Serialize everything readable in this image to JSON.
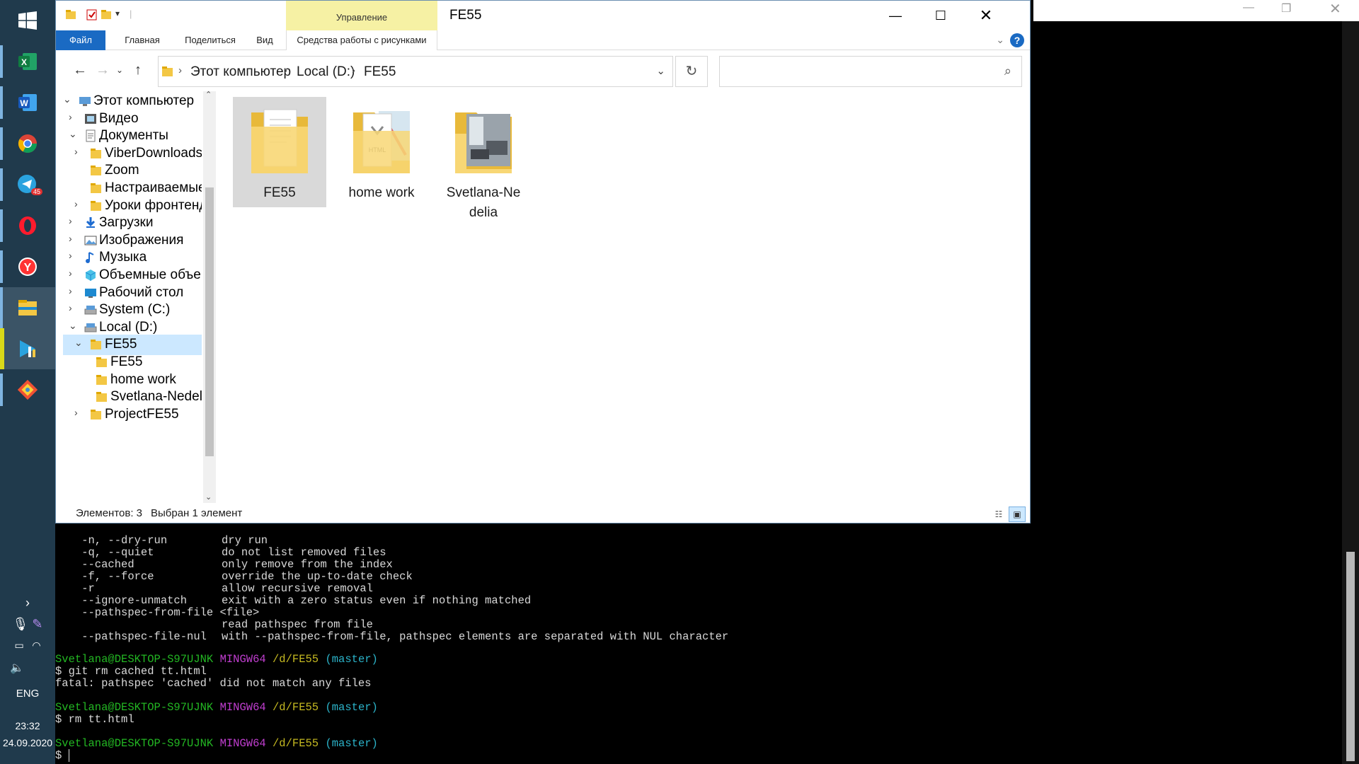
{
  "taskbar": {
    "apps": [
      "windows-start",
      "excel",
      "word",
      "chrome",
      "telegram",
      "opera",
      "yandex",
      "file-explorer",
      "ide",
      "git"
    ],
    "telegram_badge": "45",
    "tray": {
      "lang": "ENG",
      "time": "23:32",
      "date": "24.09.2020"
    }
  },
  "explorer": {
    "title": "FE55",
    "manage_tab": "Управление",
    "ribbon": {
      "file": "Файл",
      "home": "Главная",
      "share": "Поделиться",
      "view": "Вид",
      "picture_tools": "Средства работы с рисунками"
    },
    "address": [
      "Этот компьютер",
      "Local (D:)",
      "FE55"
    ],
    "search_placeholder": "",
    "tree": [
      {
        "label": "Этот компьютер",
        "icon": "computer-icon",
        "level": 0,
        "expanded": true
      },
      {
        "label": "Видео",
        "icon": "video-icon",
        "level": 1,
        "expanded": false
      },
      {
        "label": "Документы",
        "icon": "documents-icon",
        "level": 1,
        "expanded": true
      },
      {
        "label": "ViberDownloads",
        "icon": "folder-icon",
        "level": 2,
        "expanded": false
      },
      {
        "label": "Zoom",
        "icon": "folder-icon",
        "level": 2,
        "leaf": true
      },
      {
        "label": "Настраиваемые",
        "icon": "folder-icon",
        "level": 2,
        "leaf": true
      },
      {
        "label": "Уроки фронтенд",
        "icon": "folder-icon",
        "level": 2,
        "expanded": false
      },
      {
        "label": "Загрузки",
        "icon": "download-icon",
        "level": 1,
        "expanded": false
      },
      {
        "label": "Изображения",
        "icon": "pictures-icon",
        "level": 1,
        "expanded": false
      },
      {
        "label": "Музыка",
        "icon": "music-icon",
        "level": 1,
        "expanded": false
      },
      {
        "label": "Объемные объекты",
        "icon": "3d-objects-icon",
        "level": 1,
        "expanded": false
      },
      {
        "label": "Рабочий стол",
        "icon": "desktop-icon",
        "level": 1,
        "expanded": false
      },
      {
        "label": "System (C:)",
        "icon": "drive-icon",
        "level": 1,
        "expanded": false
      },
      {
        "label": "Local (D:)",
        "icon": "drive-icon",
        "level": 1,
        "expanded": true
      },
      {
        "label": "FE55",
        "icon": "folder-icon",
        "level": 2,
        "expanded": true,
        "selected": true
      },
      {
        "label": "FE55",
        "icon": "folder-icon",
        "level": 3,
        "leaf": true
      },
      {
        "label": "home work",
        "icon": "folder-icon",
        "level": 3,
        "leaf": true
      },
      {
        "label": "Svetlana-Nedelia",
        "icon": "folder-icon",
        "level": 3,
        "leaf": true
      },
      {
        "label": "ProjectFE55",
        "icon": "folder-icon",
        "level": 2,
        "expanded": false
      }
    ],
    "files": [
      {
        "name": "FE55",
        "selected": true,
        "thumb": "document"
      },
      {
        "name": "home work",
        "selected": false,
        "thumb": "html"
      },
      {
        "name": "Svetlana-Ne delia",
        "selected": false,
        "thumb": "photo"
      }
    ],
    "status": {
      "count": "Элементов: 3",
      "selected": "Выбран 1 элемент"
    }
  },
  "terminal": {
    "left_fragments": [
      "Y",
      "$",
      "",
      "",
      "$",
      "",
      "",
      "$",
      "",
      "S",
      "$",
      "O",
      "Y",
      "",
      "C",
      "",
      "",
      "",
      "C",
      "",
      "",
      "",
      "",
      "",
      "",
      "",
      "",
      "S",
      "$",
      "e",
      "u"
    ],
    "options": [
      {
        "opt": "    -n, --dry-run",
        "desc": "dry run"
      },
      {
        "opt": "    -q, --quiet",
        "desc": "do not list removed files"
      },
      {
        "opt": "    --cached",
        "desc": "only remove from the index"
      },
      {
        "opt": "    -f, --force",
        "desc": "override the up-to-date check"
      },
      {
        "opt": "    -r",
        "desc": "allow recursive removal"
      },
      {
        "opt": "    --ignore-unmatch",
        "desc": "exit with a zero status even if nothing matched"
      },
      {
        "opt": "    --pathspec-from-file <file>",
        "desc": ""
      },
      {
        "opt": "",
        "desc": "read pathspec from file"
      },
      {
        "opt": "    --pathspec-file-nul",
        "desc": "with --pathspec-from-file, pathspec elements are separated with NUL character"
      }
    ],
    "prompt_user": "Svetlana@DESKTOP-S97UJNK",
    "prompt_env": "MINGW64",
    "prompt_path": "/d/FE55",
    "prompt_branch": "(master)",
    "cmd1": "$ git rm cached tt.html",
    "out1": "fatal: pathspec 'cached' did not match any files",
    "cmd2": "$ rm tt.html",
    "cmd3": "$ "
  }
}
